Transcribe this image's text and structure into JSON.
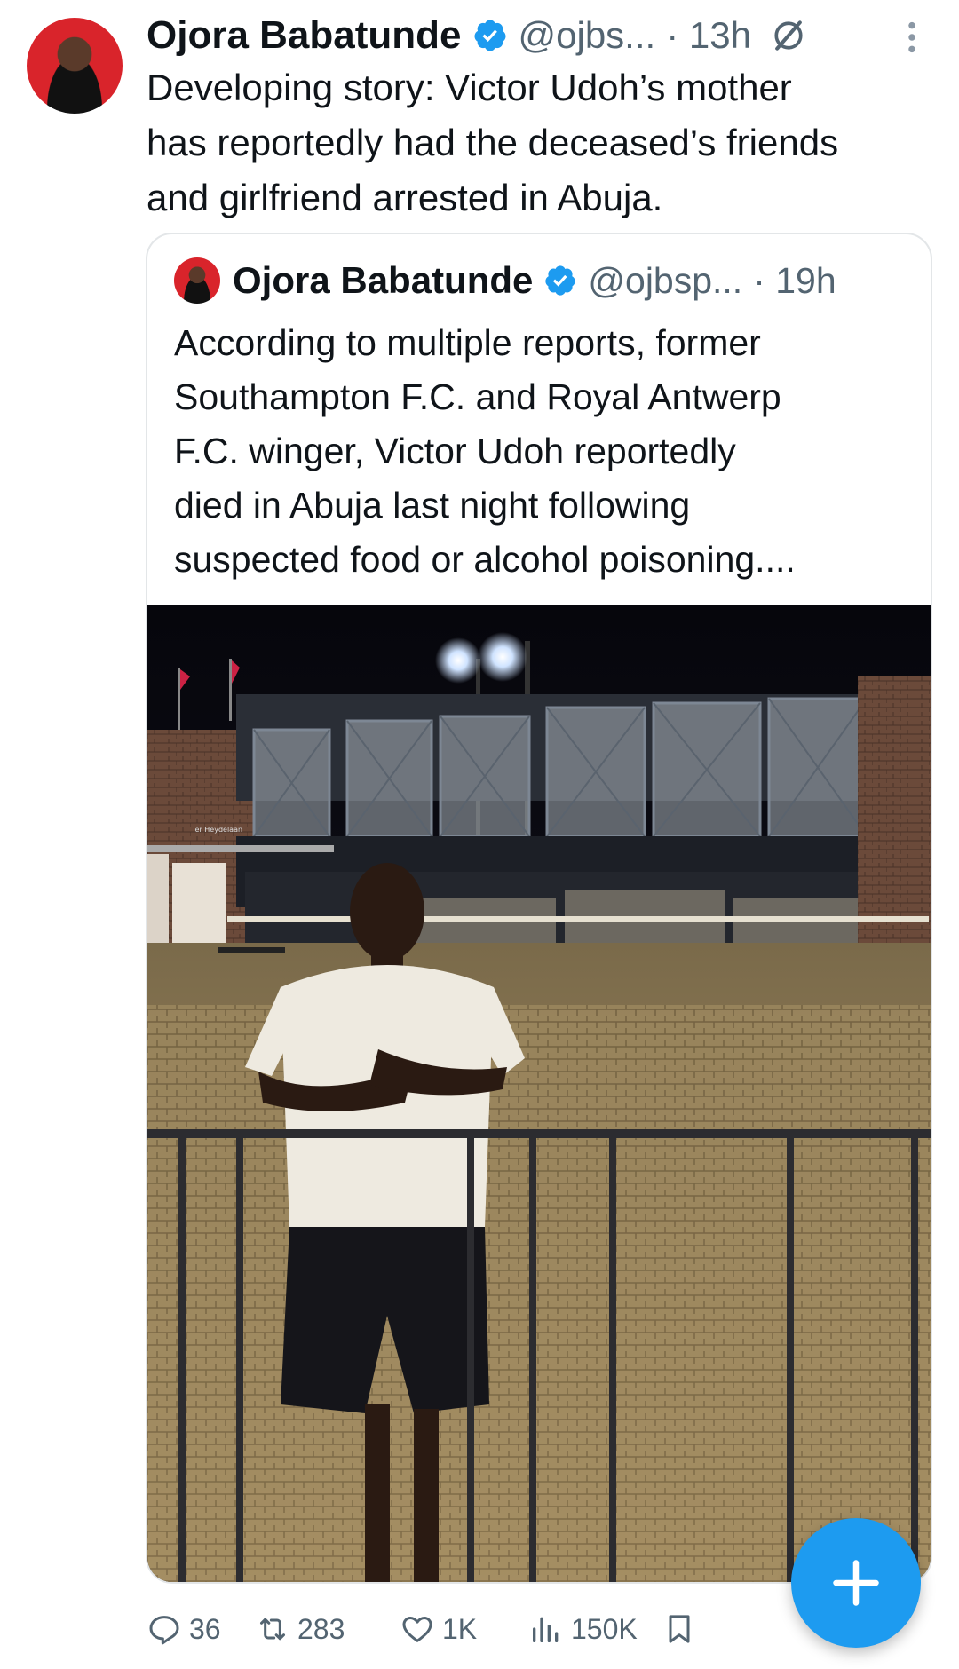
{
  "tweet": {
    "author_name": "Ojora Babatunde",
    "handle": "@ojbs...",
    "time": "· 13h",
    "text_lines": [
      "Developing story: Victor Udoh’s mother",
      "has reportedly had the deceased’s friends",
      "and girlfriend arrested in Abuja."
    ]
  },
  "quote": {
    "author_name": "Ojora Babatunde",
    "handle": "@ojbsp...",
    "time": "· 19h",
    "text_lines": [
      "According to multiple reports, former",
      "Southampton F.C. and Royal Antwerp",
      "F.C. winger, Victor Udoh reportedly",
      "died in Abuja last night following",
      "suspected food or alcohol poisoning...."
    ],
    "photo_sign": "Ter Heydelaan"
  },
  "actions": {
    "replies": "36",
    "reposts": "283",
    "likes": "1K",
    "views": "150K"
  },
  "colors": {
    "accent": "#1d9bf0",
    "muted": "#536471",
    "avatar_bg": "#d9242b"
  },
  "icons": [
    "verified-badge-icon",
    "grok-icon",
    "more-vertical-icon",
    "reply-icon",
    "repost-icon",
    "like-icon",
    "views-icon",
    "bookmark-icon",
    "compose-plus-icon"
  ]
}
